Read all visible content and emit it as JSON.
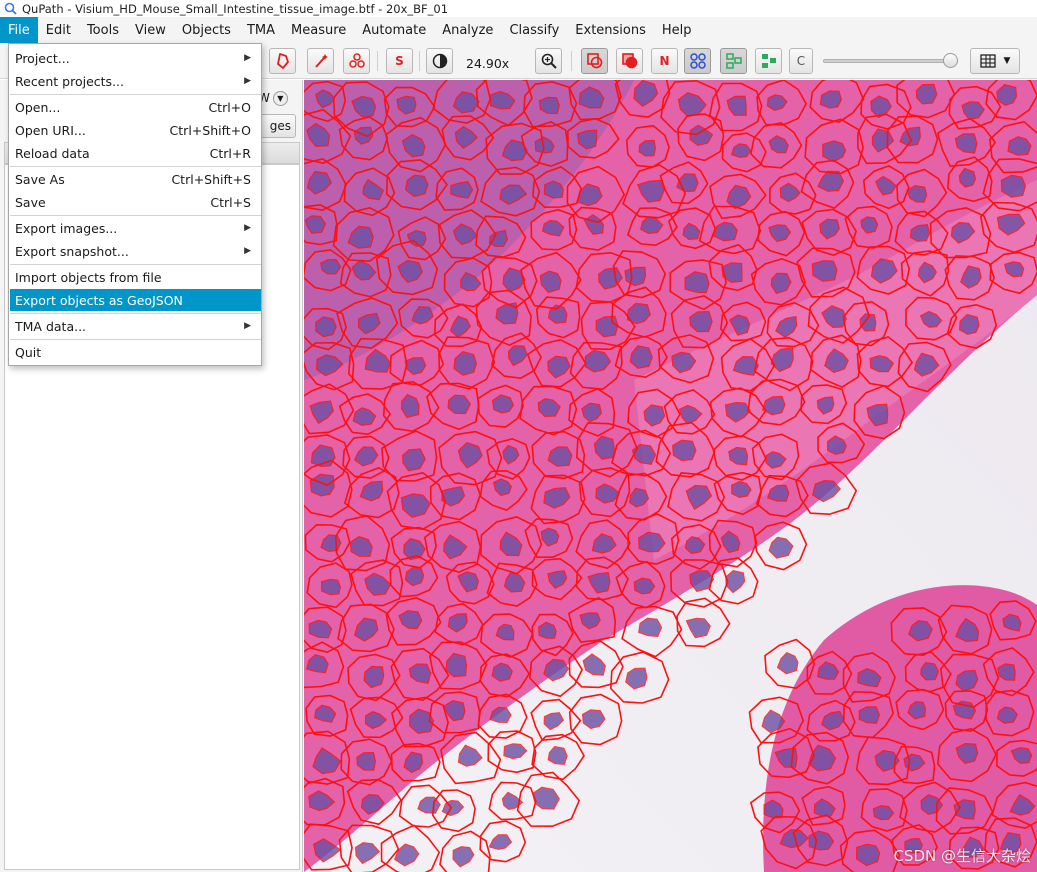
{
  "window": {
    "title": "QuPath - Visium_HD_Mouse_Small_Intestine_tissue_image.btf - 20x_BF_01"
  },
  "menubar": {
    "items": [
      "File",
      "Edit",
      "Tools",
      "View",
      "Objects",
      "TMA",
      "Measure",
      "Automate",
      "Analyze",
      "Classify",
      "Extensions",
      "Help"
    ],
    "active": "File"
  },
  "toolbar": {
    "zoom": "24.90x",
    "letter_s": "S",
    "letter_n": "N",
    "letter_c": "C",
    "slider_level": 0.95
  },
  "left_panel": {
    "combo_tail": "W",
    "button_tail": "ges"
  },
  "file_menu": {
    "items": [
      {
        "label": "Project...",
        "submenu": true
      },
      {
        "label": "Recent projects...",
        "submenu": true
      },
      {
        "label": "Open...",
        "accel": "Ctrl+O"
      },
      {
        "label": "Open URI...",
        "accel": "Ctrl+Shift+O"
      },
      {
        "label": "Reload data",
        "accel": "Ctrl+R"
      },
      {
        "label": "Save As",
        "accel": "Ctrl+Shift+S"
      },
      {
        "label": "Save",
        "accel": "Ctrl+S"
      },
      {
        "label": "Export images...",
        "submenu": true
      },
      {
        "label": "Export snapshot...",
        "submenu": true
      },
      {
        "label": "Import objects from file"
      },
      {
        "label": "Export objects as GeoJSON",
        "highlighted": true
      },
      {
        "label": "TMA data...",
        "submenu": true
      },
      {
        "label": "Quit"
      }
    ]
  },
  "viewer": {
    "watermark": "CSDN @生信大杂烩"
  },
  "colors": {
    "accent": "#0096c9",
    "cell_outline": "#ff1010",
    "tissue_pink": "#e35aa6",
    "nucleus_purple": "#6c4fa3"
  }
}
